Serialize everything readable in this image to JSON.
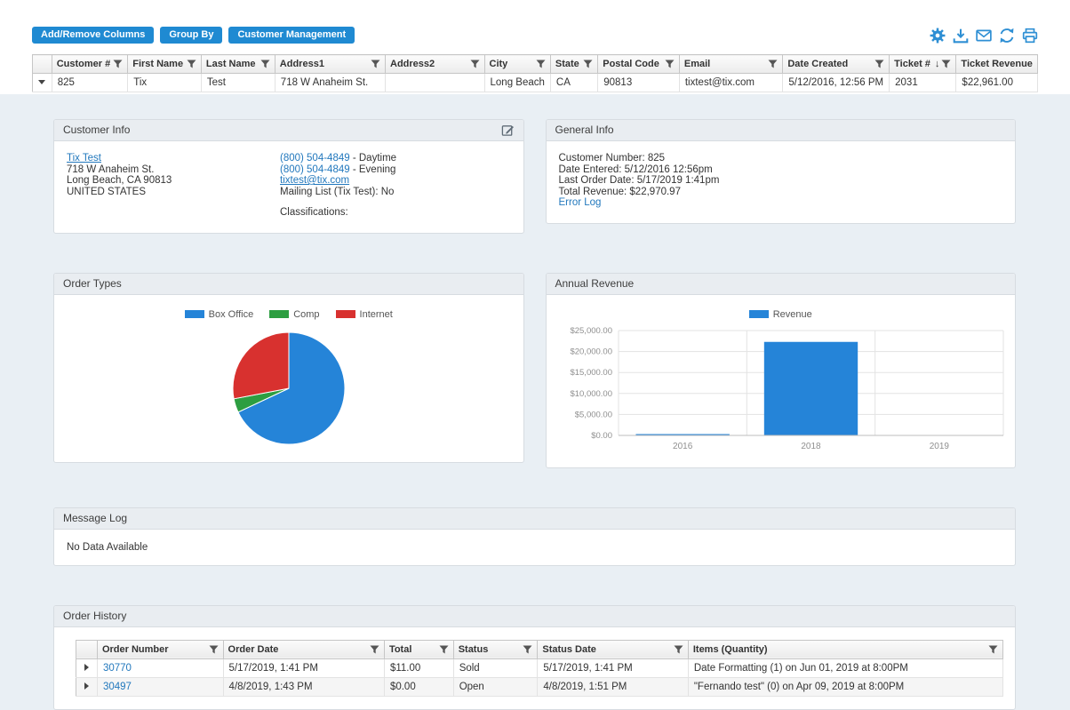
{
  "toolbar": {
    "buttons": [
      "Add/Remove Columns",
      "Group By",
      "Customer Management"
    ],
    "icons": [
      "settings",
      "export",
      "email",
      "refresh",
      "print"
    ],
    "accent_color": "#1f8ad2",
    "icon_color": "#2e8fd4"
  },
  "customer_grid": {
    "columns": [
      {
        "label": "Customer #"
      },
      {
        "label": "First Name"
      },
      {
        "label": "Last Name"
      },
      {
        "label": "Address1"
      },
      {
        "label": "Address2"
      },
      {
        "label": "City"
      },
      {
        "label": "State"
      },
      {
        "label": "Postal Code"
      },
      {
        "label": "Email"
      },
      {
        "label": "Date Created"
      },
      {
        "label": "Ticket #",
        "sort": "desc",
        "sort_glyph": "↓"
      },
      {
        "label": "Ticket Revenue"
      }
    ],
    "rows": [
      {
        "customer_number": "825",
        "first_name": "Tix",
        "last_name": "Test",
        "address1": "718 W Anaheim St.",
        "address2": "",
        "city": "Long Beach",
        "state": "CA",
        "postal_code": "90813",
        "email": "tixtest@tix.com",
        "date_created": "5/12/2016, 12:56 PM",
        "ticket_number": "2031",
        "ticket_revenue": "$22,961.00"
      }
    ]
  },
  "customer_info": {
    "title": "Customer Info",
    "name": "Tix Test",
    "address1": "718 W Anaheim St.",
    "address2": "Long Beach, CA 90813",
    "country": "UNITED STATES",
    "phone_daytime": "(800) 504-4849",
    "phone_daytime_suffix": " - Daytime",
    "phone_evening": "(800) 504-4849",
    "phone_evening_suffix": " - Evening",
    "email": "tixtest@tix.com",
    "mailing_list": "Mailing List (Tix Test): No",
    "classifications_label": "Classifications:"
  },
  "general_info": {
    "title": "General Info",
    "customer_number": "Customer Number: 825",
    "date_entered": "Date Entered: 5/12/2016 12:56pm",
    "last_order_date": "Last Order Date: 5/17/2019 1:41pm",
    "total_revenue": "Total Revenue: $22,970.97",
    "error_log_link": "Error Log"
  },
  "chart_data": [
    {
      "type": "pie",
      "title": "Order Types",
      "labels": [
        "Box Office",
        "Comp",
        "Internet"
      ],
      "values": [
        68,
        4,
        28
      ],
      "colors": [
        "#2584d8",
        "#2d9e41",
        "#d8312f"
      ],
      "legend_position": "top"
    },
    {
      "type": "bar",
      "title": "Annual Revenue",
      "categories": [
        "2016",
        "2018",
        "2019"
      ],
      "series": [
        {
          "name": "Revenue",
          "values": [
            300,
            22300,
            0
          ]
        }
      ],
      "ylim": [
        0,
        25000
      ],
      "ytick_labels": [
        "$0.00",
        "$5,000.00",
        "$10,000.00",
        "$15,000.00",
        "$20,000.00",
        "$25,000.00"
      ],
      "bar_color": "#2584d8",
      "grid": true,
      "legend_position": "top"
    }
  ],
  "message_log": {
    "title": "Message Log",
    "empty_text": "No Data Available"
  },
  "order_history": {
    "title": "Order History",
    "columns": [
      {
        "label": "Order Number"
      },
      {
        "label": "Order Date"
      },
      {
        "label": "Total"
      },
      {
        "label": "Status"
      },
      {
        "label": "Status Date"
      },
      {
        "label": "Items (Quantity)"
      }
    ],
    "rows": [
      {
        "order_number": "30770",
        "order_date": "5/17/2019, 1:41 PM",
        "total": "$11.00",
        "status": "Sold",
        "status_date": "5/17/2019, 1:41 PM",
        "items": "Date Formatting (1) on Jun 01, 2019 at 8:00PM"
      },
      {
        "order_number": "30497",
        "order_date": "4/8/2019, 1:43 PM",
        "total": "$0.00",
        "status": "Open",
        "status_date": "4/8/2019, 1:51 PM",
        "items": "\"Fernando test\" (0) on Apr 09, 2019 at 8:00PM"
      }
    ]
  }
}
